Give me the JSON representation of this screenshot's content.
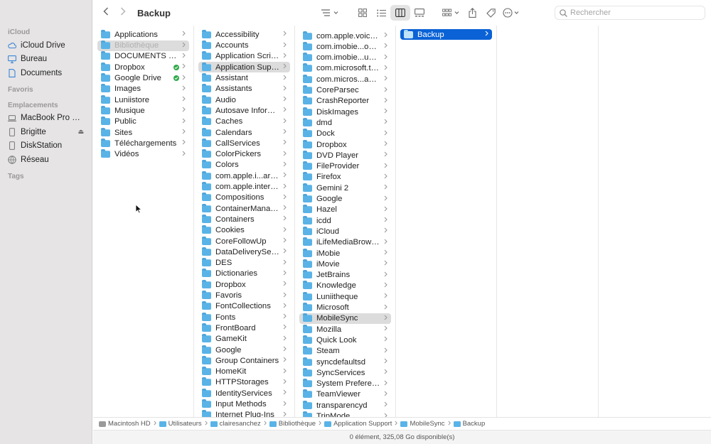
{
  "window": {
    "title": "Backup"
  },
  "toolbar": {
    "back_icon": "chevron-left-icon",
    "forward_icon": "chevron-right-icon",
    "search_placeholder": "Rechercher"
  },
  "sidebar": {
    "sections": [
      {
        "label": "iCloud",
        "items": [
          {
            "label": "iCloud Drive",
            "icon": "cloud-icon"
          },
          {
            "label": "Bureau",
            "icon": "desktop-icon"
          },
          {
            "label": "Documents",
            "icon": "document-icon"
          }
        ]
      },
      {
        "label": "Favoris",
        "items": []
      },
      {
        "label": "Emplacements",
        "items": [
          {
            "label": "MacBook Pro de Cl...",
            "icon": "laptop-icon"
          },
          {
            "label": "Brigitte",
            "icon": "drive-icon",
            "eject": "⏏"
          },
          {
            "label": "DiskStation",
            "icon": "drive-icon"
          },
          {
            "label": "Réseau",
            "icon": "network-icon"
          }
        ]
      },
      {
        "label": "Tags",
        "items": []
      }
    ]
  },
  "columns": [
    {
      "items": [
        {
          "name": "Applications"
        },
        {
          "name": "Bibliothèque",
          "state": "grey",
          "dim": true
        },
        {
          "name": "DOCUMENTS LOCAL"
        },
        {
          "name": "Dropbox",
          "badge": "green"
        },
        {
          "name": "Google Drive",
          "badge": "green"
        },
        {
          "name": "Images"
        },
        {
          "name": "Luniistore"
        },
        {
          "name": "Musique"
        },
        {
          "name": "Public"
        },
        {
          "name": "Sites"
        },
        {
          "name": "Téléchargements"
        },
        {
          "name": "Vidéos"
        }
      ]
    },
    {
      "items": [
        {
          "name": "Accessibility"
        },
        {
          "name": "Accounts"
        },
        {
          "name": "Application Scripts"
        },
        {
          "name": "Application Support",
          "state": "grey"
        },
        {
          "name": "Assistant"
        },
        {
          "name": "Assistants"
        },
        {
          "name": "Audio"
        },
        {
          "name": "Autosave Information"
        },
        {
          "name": "Caches"
        },
        {
          "name": "Calendars"
        },
        {
          "name": "CallServices"
        },
        {
          "name": "ColorPickers"
        },
        {
          "name": "Colors"
        },
        {
          "name": "com.apple.i...archpartyd"
        },
        {
          "name": "com.apple.internal.ck"
        },
        {
          "name": "Compositions"
        },
        {
          "name": "ContainerManager"
        },
        {
          "name": "Containers"
        },
        {
          "name": "Cookies"
        },
        {
          "name": "CoreFollowUp"
        },
        {
          "name": "DataDeliveryServices"
        },
        {
          "name": "DES"
        },
        {
          "name": "Dictionaries"
        },
        {
          "name": "Dropbox"
        },
        {
          "name": "Favoris"
        },
        {
          "name": "FontCollections"
        },
        {
          "name": "Fonts"
        },
        {
          "name": "FrontBoard"
        },
        {
          "name": "GameKit"
        },
        {
          "name": "Google"
        },
        {
          "name": "Group Containers"
        },
        {
          "name": "HomeKit"
        },
        {
          "name": "HTTPStorages"
        },
        {
          "name": "IdentityServices"
        },
        {
          "name": "Input Methods"
        },
        {
          "name": "Internet Plug-Ins"
        }
      ]
    },
    {
      "items": [
        {
          "name": "com.apple.voicememos"
        },
        {
          "name": "com.imobie...oneRescue"
        },
        {
          "name": "com.imobie...ue-Installer"
        },
        {
          "name": "com.microsoft.teams"
        },
        {
          "name": "com.micros...ams.helper"
        },
        {
          "name": "CoreParsec"
        },
        {
          "name": "CrashReporter"
        },
        {
          "name": "DiskImages"
        },
        {
          "name": "dmd"
        },
        {
          "name": "Dock"
        },
        {
          "name": "Dropbox"
        },
        {
          "name": "DVD Player"
        },
        {
          "name": "FileProvider"
        },
        {
          "name": "Firefox"
        },
        {
          "name": "Gemini 2"
        },
        {
          "name": "Google"
        },
        {
          "name": "Hazel"
        },
        {
          "name": "icdd"
        },
        {
          "name": "iCloud"
        },
        {
          "name": "iLifeMediaBrowser"
        },
        {
          "name": "iMobie"
        },
        {
          "name": "iMovie"
        },
        {
          "name": "JetBrains"
        },
        {
          "name": "Knowledge"
        },
        {
          "name": "Luniitheque"
        },
        {
          "name": "Microsoft"
        },
        {
          "name": "MobileSync",
          "state": "grey"
        },
        {
          "name": "Mozilla"
        },
        {
          "name": "Quick Look"
        },
        {
          "name": "Steam"
        },
        {
          "name": "syncdefaultsd"
        },
        {
          "name": "SyncServices"
        },
        {
          "name": "System Preferences"
        },
        {
          "name": "TeamViewer"
        },
        {
          "name": "transparencyd"
        },
        {
          "name": "TripMode"
        }
      ]
    },
    {
      "items": [
        {
          "name": "Backup",
          "state": "blue"
        }
      ]
    }
  ],
  "pathbar": [
    "Macintosh HD",
    "Utilisateurs",
    "clairesanchez",
    "Bibliothèque",
    "Application Support",
    "MobileSync",
    "Backup"
  ],
  "status": "0 élément, 325,08 Go disponible(s)",
  "colors": {
    "accent": "#0a62d6",
    "folder": "#5ab3e6",
    "sidebar": "#e6e4e5",
    "sync_ok": "#2faa4a"
  }
}
